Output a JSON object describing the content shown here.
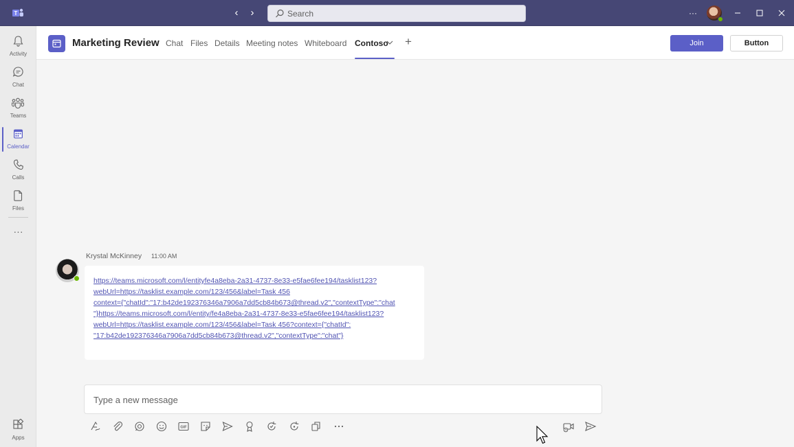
{
  "titlebar": {
    "search_placeholder": "Search",
    "more_label": "···"
  },
  "rail": {
    "items": [
      {
        "label": "Activity",
        "icon": "bell-icon"
      },
      {
        "label": "Chat",
        "icon": "chat-icon"
      },
      {
        "label": "Teams",
        "icon": "teams-icon"
      },
      {
        "label": "Calendar",
        "icon": "calendar-icon",
        "active": true
      },
      {
        "label": "Calls",
        "icon": "phone-icon"
      },
      {
        "label": "Files",
        "icon": "file-icon"
      }
    ],
    "more_label": "···",
    "apps_label": "Apps"
  },
  "header": {
    "title": "Marketing Review",
    "tabs": [
      {
        "label": "Chat"
      },
      {
        "label": "Files"
      },
      {
        "label": "Details"
      },
      {
        "label": "Meeting notes"
      },
      {
        "label": "Whiteboard"
      },
      {
        "label": "Contoso",
        "active": true
      }
    ],
    "add_tab": "+",
    "join_label": "Join",
    "button_label": "Button"
  },
  "message": {
    "sender": "Krystal McKinney",
    "time": "11:00 AM",
    "lines": [
      "https://teams.microsoft.com/l/entityfe4a8eba-2a31-4737-8e33-e5fae6fee194/tasklist123?",
      "webUrl=https://tasklist.example.com/123/456&label=Task 456",
      "context={\"chatId\":\"17:b42de192376346a7906a7dd5cb84b673@thread.v2\",\"contextType\":\"chat",
      "\"}https://teams.microsoft.com/l/entity/fe4a8eba-2a31-4737-8e33-e5fae6fee194/tasklist123?",
      "webUrl=https://tasklist.example.com/123/456&label=Task 456?context={\"chatId\":",
      "\"17:b42de192376346a7906a7dd5cb84b673@thread.v2\",\"contextType\":\"chat\"}"
    ]
  },
  "compose": {
    "placeholder": "Type a new message"
  },
  "colors": {
    "titlebar": "#464775",
    "accent": "#5b5fc7",
    "presence": "#6bb700"
  }
}
